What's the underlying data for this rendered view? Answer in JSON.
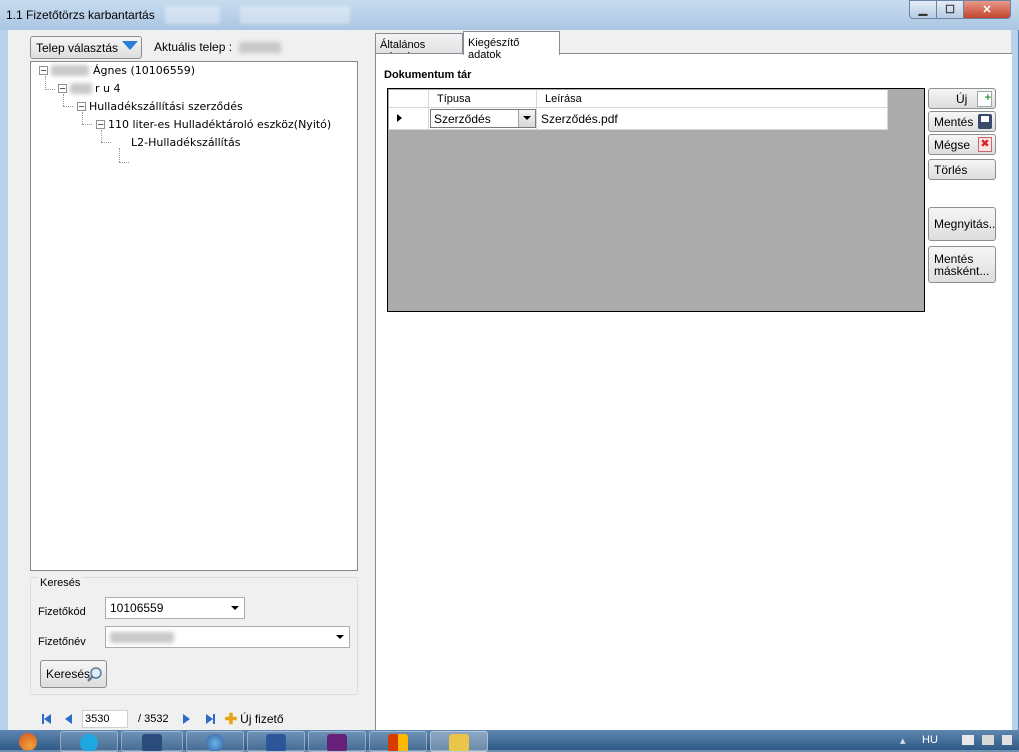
{
  "window": {
    "title": "1.1 Fizetőtörzs karbantartás",
    "controls": {
      "minimize": "▁",
      "maximize": "☐",
      "close": "✕"
    }
  },
  "left": {
    "telep_button": "Telep választás",
    "aktualis_label": "Aktuális telep :",
    "tree": {
      "root": "Ágnes (10106559)",
      "address": "r u 4",
      "contract": "Hulladékszállítási szerződés",
      "device": "110 liter-es Hulladéktároló eszköz(Nyitó)",
      "service": "L2-Hulladékszállítás",
      "expander_minus": "−"
    },
    "search": {
      "group_label": "Keresés",
      "code_label": "Fizetőkód",
      "code_value": "10106559",
      "name_label": "Fizetőnév",
      "search_button": "Keresés"
    },
    "navigator": {
      "position": "3530",
      "total": "/ 3532",
      "new_payer": "Új fizető"
    }
  },
  "tabs": [
    {
      "label": "Általános adatok"
    },
    {
      "label": "Kiegészítő adatok"
    }
  ],
  "documents": {
    "title": "Dokumentum tár",
    "columns": [
      "Típusa",
      "Leírása"
    ],
    "rows": [
      {
        "type": "Szerződés",
        "description": "Szerződés.pdf"
      }
    ],
    "buttons": {
      "new": "Új",
      "save": "Mentés",
      "cancel": "Mégse",
      "delete": "Törlés",
      "open": "Megnyitás..",
      "save_as": "Mentés másként..."
    }
  },
  "taskbar": {
    "language": "HU"
  },
  "colors": {
    "frame": "#b9d1ea",
    "grid_background": "#ababab",
    "accent": "#2c6bc9",
    "close_button": "#c2452d"
  }
}
